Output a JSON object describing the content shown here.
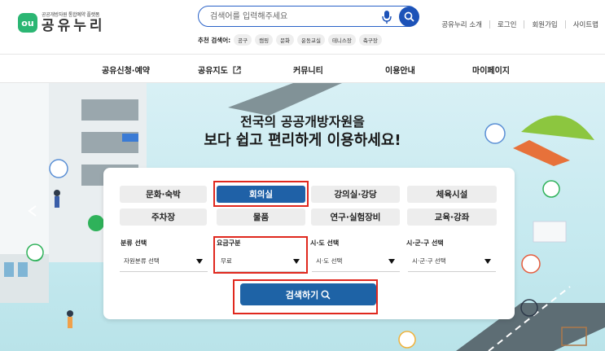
{
  "logo": {
    "subtitle": "공공개방자원 통합예약 플랫폼",
    "name": "공유누리",
    "mark": "ou"
  },
  "search": {
    "placeholder": "검색어를 입력해주세요",
    "value": ""
  },
  "recommended": {
    "label": "추천 검색어:",
    "tags": [
      "공구",
      "캠핑",
      "문화",
      "운동교실",
      "테니스장",
      "축구장"
    ]
  },
  "util_links": [
    "공유누리 소개",
    "로그인",
    "회원가입",
    "사이트맵"
  ],
  "nav": [
    {
      "label": "공유신청·예약"
    },
    {
      "label": "공유지도"
    },
    {
      "label": "커뮤니티"
    },
    {
      "label": "이용안내"
    },
    {
      "label": "마이페이지"
    }
  ],
  "hero": {
    "line1": "전국의 공공개방자원을",
    "line2": "보다 쉽고 편리하게 이용하세요!"
  },
  "categories": [
    "문화·숙박",
    "회의실",
    "강의실·강당",
    "체육시설",
    "주차장",
    "물품",
    "연구·실험장비",
    "교육·강좌"
  ],
  "active_category": "회의실",
  "filters": [
    {
      "label": "분류 선택",
      "value": "자원분류 선택"
    },
    {
      "label": "요금구분",
      "value": "무료"
    },
    {
      "label": "시·도 선택",
      "value": "시·도 선택"
    },
    {
      "label": "시·군·구 선택",
      "value": "시·군·구 선택"
    }
  ],
  "submit": {
    "label": "검색하기"
  },
  "colors": {
    "primary": "#1f61a7",
    "highlight": "#e0281e",
    "logo_green": "#2bb673",
    "search_blue": "#1c52b8"
  }
}
